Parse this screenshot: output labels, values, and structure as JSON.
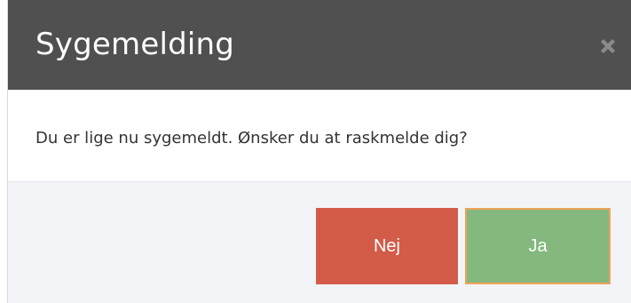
{
  "dialog": {
    "title": "Sygemelding",
    "close_icon": "close-icon",
    "message": "Du er lige nu sygemeldt. Ønsker du at raskmelde dig?",
    "buttons": {
      "no_label": "Nej",
      "yes_label": "Ja"
    }
  },
  "colors": {
    "header_bg": "#505050",
    "footer_bg": "#f2f4f8",
    "no_button": "#d25c48",
    "yes_button": "#84b87e",
    "yes_button_focus_border": "#f0a25a"
  }
}
